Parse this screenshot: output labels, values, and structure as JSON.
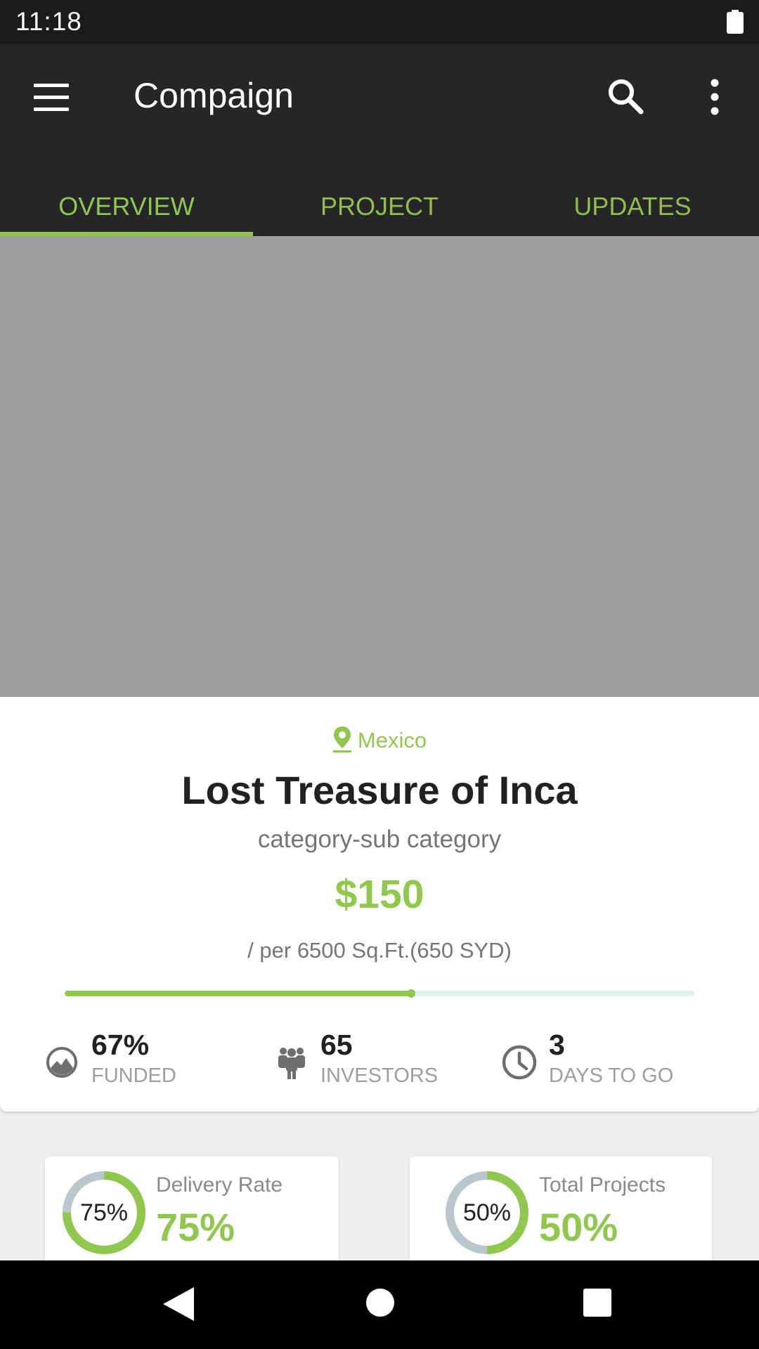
{
  "status_bar": {
    "time": "11:18",
    "battery_icon": "battery-full-icon"
  },
  "app_bar": {
    "title": "Compaign",
    "menu_icon": "hamburger-menu-icon",
    "search_icon": "search-icon",
    "more_icon": "more-vert-icon"
  },
  "tabs": [
    {
      "label": "OVERVIEW",
      "active": true
    },
    {
      "label": "PROJECT",
      "active": false
    },
    {
      "label": "UPDATES",
      "active": false
    }
  ],
  "project": {
    "location": "Mexico",
    "title": "Lost Treasure of Inca",
    "category": "category-sub category",
    "price": "$150",
    "per_unit": "/ per 6500 Sq.Ft.(650 SYD)",
    "funding_progress": 0.55
  },
  "stats": [
    {
      "value": "67%",
      "label": "FUNDED",
      "icon": "funded-pie-icon"
    },
    {
      "value": "65",
      "label": "INVESTORS",
      "icon": "investors-group-icon"
    },
    {
      "value": "3",
      "label": "DAYS TO GO",
      "icon": "clock-icon"
    }
  ],
  "mini_cards": [
    {
      "label": "Delivery Rate",
      "ring_text": "75%",
      "value": "75%",
      "fraction": 0.75
    },
    {
      "label": "Total Projects",
      "ring_text": "50%",
      "value": "50%",
      "fraction": 0.5
    }
  ],
  "colors": {
    "accent": "#8fc84d",
    "app_bar": "#262628",
    "status_bar": "#1b1b1d",
    "hero_placeholder": "#9e9e9e",
    "ring_track": "#b8c7cc"
  },
  "nav_bar": {
    "back_icon": "back-triangle-icon",
    "home_icon": "home-circle-icon",
    "recents_icon": "recents-square-icon"
  }
}
